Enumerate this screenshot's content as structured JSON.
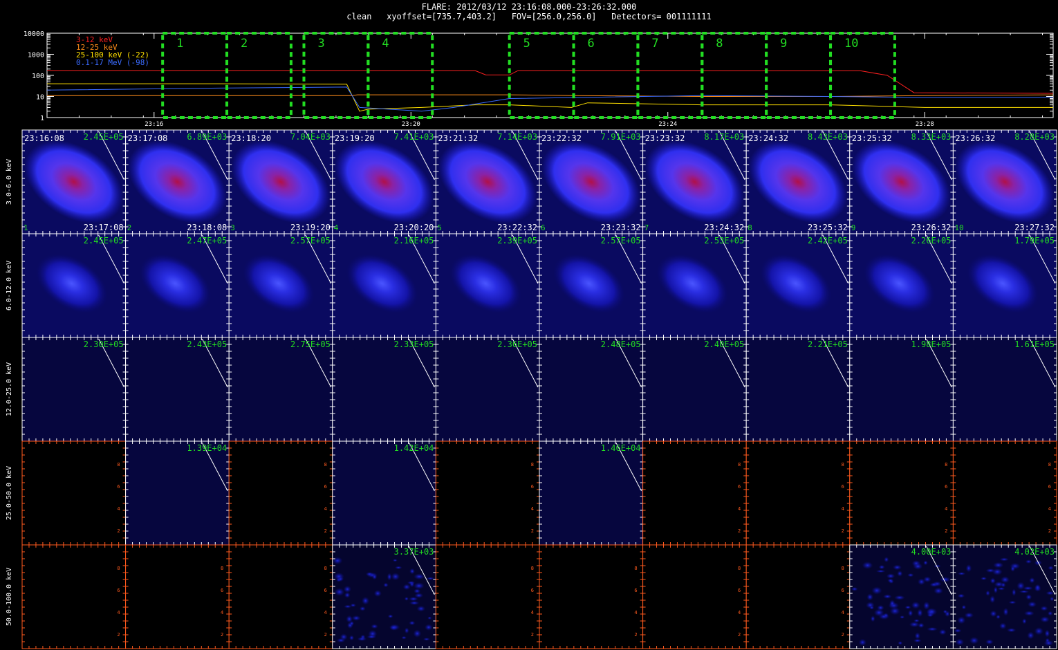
{
  "header": {
    "title": "FLARE: 2012/03/12 23:16:08.000-23:26:32.000",
    "subtitle": "clean   xyoffset=[735.7,403.2]   FOV=[256.0,256.0]   Detectors= 001111111"
  },
  "chart_data": [
    {
      "type": "line",
      "yscale": "log",
      "ylim": [
        1,
        10000
      ],
      "yticks": [
        "10000",
        "1000",
        "100",
        "10",
        "1"
      ],
      "xrange": [
        "23:14:20",
        "23:30:00"
      ],
      "xticks": [
        "23:16",
        "23:20",
        "23:24",
        "23:28"
      ],
      "grid": false,
      "legend_position": "top-left",
      "series": [
        {
          "name": "3-12 keV",
          "color": "#ff2020",
          "points": [
            [
              "23:14:20",
              170
            ],
            [
              "23:17:00",
              170
            ],
            [
              "23:21:00",
              168
            ],
            [
              "23:21:10",
              105
            ],
            [
              "23:21:32",
              105
            ],
            [
              "23:21:40",
              168
            ],
            [
              "23:27:00",
              165
            ],
            [
              "23:27:25",
              100
            ],
            [
              "23:27:50",
              15
            ],
            [
              "23:30:00",
              14
            ]
          ]
        },
        {
          "name": "12-25 keV",
          "color": "#ff8c1a",
          "points": [
            [
              "23:14:20",
              11
            ],
            [
              "23:17:00",
              11
            ],
            [
              "23:19:05",
              11
            ],
            [
              "23:19:10",
              12
            ],
            [
              "23:21:32",
              12
            ],
            [
              "23:22:32",
              11
            ],
            [
              "23:24:32",
              10
            ],
            [
              "23:26:32",
              10
            ],
            [
              "23:28:00",
              11
            ],
            [
              "23:30:00",
              12
            ]
          ]
        },
        {
          "name": "25-100 keV (-22)",
          "color": "#ffe000",
          "points": [
            [
              "23:14:20",
              40
            ],
            [
              "23:17:00",
              40
            ],
            [
              "23:19:00",
              38
            ],
            [
              "23:19:12",
              2
            ],
            [
              "23:19:20",
              2.5
            ],
            [
              "23:20:10",
              3
            ],
            [
              "23:21:00",
              4
            ],
            [
              "23:21:32",
              4
            ],
            [
              "23:22:30",
              3
            ],
            [
              "23:22:45",
              5
            ],
            [
              "23:24:32",
              4
            ],
            [
              "23:26:32",
              4
            ],
            [
              "23:28:00",
              3
            ],
            [
              "23:30:00",
              3
            ]
          ]
        },
        {
          "name": "0.1-17 MeV (-98)",
          "color": "#3a6bff",
          "points": [
            [
              "23:14:20",
              20
            ],
            [
              "23:17:00",
              25
            ],
            [
              "23:19:00",
              28
            ],
            [
              "23:19:12",
              3
            ],
            [
              "23:20:10",
              2
            ],
            [
              "23:20:40",
              3
            ],
            [
              "23:21:32",
              8
            ],
            [
              "23:22:40",
              9
            ],
            [
              "23:24:32",
              11
            ],
            [
              "23:26:32",
              10
            ],
            [
              "23:28:00",
              9
            ],
            [
              "23:30:00",
              9
            ]
          ]
        }
      ],
      "intervals": [
        {
          "label": "1",
          "start": "23:16:08",
          "end": "23:17:08"
        },
        {
          "label": "2",
          "start": "23:17:08",
          "end": "23:18:08"
        },
        {
          "label": "3",
          "start": "23:18:20",
          "end": "23:19:20"
        },
        {
          "label": "4",
          "start": "23:19:20",
          "end": "23:20:20"
        },
        {
          "label": "5",
          "start": "23:21:32",
          "end": "23:22:32"
        },
        {
          "label": "6",
          "start": "23:22:32",
          "end": "23:23:32"
        },
        {
          "label": "7",
          "start": "23:23:32",
          "end": "23:24:32"
        },
        {
          "label": "8",
          "start": "23:24:32",
          "end": "23:25:32"
        },
        {
          "label": "9",
          "start": "23:25:32",
          "end": "23:26:32"
        },
        {
          "label": "10",
          "start": "23:26:32",
          "end": "23:27:32"
        }
      ]
    },
    {
      "type": "heatmap",
      "row_labels": [
        "3.0-6.0 keV",
        "6.0-12.0 keV",
        "12.0-25.0 keV",
        "25.0-50.0 keV",
        "50.0-100.0 keV"
      ],
      "columns": [
        {
          "index": "1",
          "start": "23:16:08",
          "end": "23:17:08"
        },
        {
          "index": "2",
          "start": "23:17:08",
          "end": "23:18:08"
        },
        {
          "index": "3",
          "start": "23:18:20",
          "end": "23:19:20"
        },
        {
          "index": "4",
          "start": "23:19:20",
          "end": "23:20:20"
        },
        {
          "index": "5",
          "start": "23:21:32",
          "end": "23:22:32"
        },
        {
          "index": "6",
          "start": "23:22:32",
          "end": "23:23:32"
        },
        {
          "index": "7",
          "start": "23:23:32",
          "end": "23:24:32"
        },
        {
          "index": "8",
          "start": "23:24:32",
          "end": "23:25:32"
        },
        {
          "index": "9",
          "start": "23:25:32",
          "end": "23:26:32"
        },
        {
          "index": "10",
          "start": "23:26:32",
          "end": "23:27:32"
        }
      ],
      "peaks": [
        [
          "2.45E+05",
          "6.89E+03",
          "7.04E+03",
          "7.41E+03",
          "7.14E+03",
          "7.91E+03",
          "8.17E+03",
          "8.43E+03",
          "8.33E+03",
          "8.28E+03"
        ],
        [
          "2.45E+05",
          "2.47E+05",
          "2.57E+05",
          "2.16E+05",
          "2.39E+05",
          "2.57E+05",
          "2.53E+05",
          "2.42E+05",
          "2.26E+05",
          "1.79E+05"
        ],
        [
          "2.30E+05",
          "2.43E+05",
          "2.75E+05",
          "2.33E+05",
          "2.36E+05",
          "2.48E+05",
          "2.40E+05",
          "2.21E+05",
          "1.98E+05",
          "1.61E+05"
        ],
        [
          "",
          "1.39E+04",
          "",
          "1.42E+04",
          "",
          "1.46E+04",
          "",
          "",
          "",
          ""
        ],
        [
          "",
          "",
          "",
          "3.37E+03",
          "",
          "",
          "",
          "",
          "4.00E+03",
          "4.02E+03"
        ]
      ],
      "image_kind": [
        [
          "full",
          "full",
          "full",
          "full",
          "full",
          "full",
          "full",
          "full",
          "full",
          "full"
        ],
        [
          "mid",
          "mid",
          "mid",
          "mid",
          "mid",
          "mid",
          "mid",
          "mid",
          "mid",
          "mid"
        ],
        [
          "faint",
          "faint",
          "faint",
          "faint",
          "faint",
          "faint",
          "faint",
          "faint",
          "faint",
          "faint"
        ],
        [
          "none",
          "faint",
          "none",
          "faint",
          "none",
          "faint",
          "none",
          "none",
          "none",
          "none"
        ],
        [
          "none",
          "none",
          "none",
          "noise",
          "none",
          "none",
          "none",
          "none",
          "noise",
          "noise"
        ]
      ],
      "empty_axis_ticks": [
        "2",
        "4",
        "6",
        "8"
      ]
    }
  ]
}
